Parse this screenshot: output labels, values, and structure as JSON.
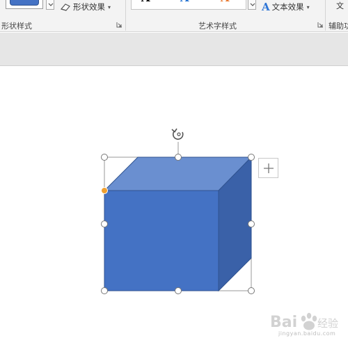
{
  "ribbon": {
    "shape_effects_label": "形状效果",
    "text_effects_label": "文本效果",
    "text_effects_glyph": "A",
    "groups": {
      "shape_styles": "形状样式",
      "wordart_styles": "艺术字样式",
      "accessibility_partial": "辅助功"
    },
    "cut_off_text": "文"
  },
  "wordart_samples": [
    {
      "glyph": "A",
      "color": "#000000"
    },
    {
      "glyph": "A",
      "color": "#1f6fd0"
    },
    {
      "glyph": "A",
      "color": "#e8772e"
    }
  ],
  "shape": {
    "type": "3d-cube",
    "front_color": "#4472c4",
    "top_color": "#6a8fd0",
    "side_color": "#3a61a8",
    "handle_adjust_color": "#f0a030"
  },
  "watermark": {
    "brand": "Baidu经验",
    "url": "jingyan.baidu.com"
  },
  "colors": {
    "ribbon_bg": "#f3f3f3",
    "band_bg": "#e6e6e6",
    "accent_blue": "#4472c4"
  }
}
